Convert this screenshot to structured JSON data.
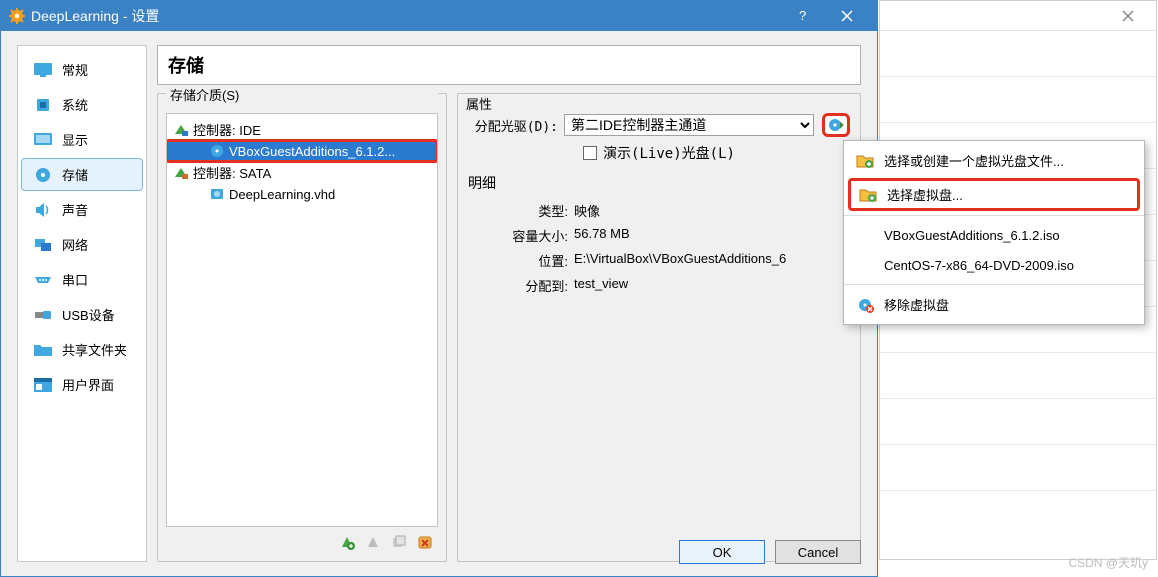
{
  "window": {
    "title": "DeepLearning - 设置"
  },
  "sidebar": {
    "items": [
      {
        "label": "常规",
        "icon": "monitor",
        "sel": false
      },
      {
        "label": "系统",
        "icon": "chip",
        "sel": false
      },
      {
        "label": "显示",
        "icon": "display",
        "sel": false
      },
      {
        "label": "存储",
        "icon": "disk",
        "sel": true
      },
      {
        "label": "声音",
        "icon": "speaker",
        "sel": false
      },
      {
        "label": "网络",
        "icon": "net",
        "sel": false
      },
      {
        "label": "串口",
        "icon": "serial",
        "sel": false
      },
      {
        "label": "USB设备",
        "icon": "usb",
        "sel": false
      },
      {
        "label": "共享文件夹",
        "icon": "folder",
        "sel": false
      },
      {
        "label": "用户界面",
        "icon": "ui",
        "sel": false
      }
    ]
  },
  "page": {
    "title": "存储"
  },
  "storage": {
    "media_legend": "存储介质(S)",
    "tree": [
      {
        "kind": "controller",
        "label": "控制器: IDE",
        "icon": "ide"
      },
      {
        "kind": "leaf",
        "label": "VBoxGuestAdditions_6.1.2...",
        "icon": "disc",
        "sel": true,
        "highlight": true
      },
      {
        "kind": "controller",
        "label": "控制器: SATA",
        "icon": "sata"
      },
      {
        "kind": "leaf",
        "label": "DeepLearning.vhd",
        "icon": "hdd",
        "sel": false
      }
    ]
  },
  "attrs": {
    "legend": "属性",
    "drive_label": "分配光驱(D):",
    "drive_value": "第二IDE控制器主通道",
    "live_checkbox": "演示(Live)光盘(L)",
    "details_legend": "明细",
    "rows": [
      {
        "label": "类型:",
        "value": "映像"
      },
      {
        "label": "容量大小:",
        "value": "56.78  MB"
      },
      {
        "label": "位置:",
        "value": "E:\\VirtualBox\\VBoxGuestAdditions_6"
      },
      {
        "label": "分配到:",
        "value": "test_view"
      }
    ]
  },
  "popup": {
    "items": [
      {
        "label": "选择或创建一个虚拟光盘文件...",
        "icon": "folder-add"
      },
      {
        "label": "选择虚拟盘...",
        "icon": "folder-add",
        "highlight": true
      }
    ],
    "recent": [
      "VBoxGuestAdditions_6.1.2.iso",
      "CentOS-7-x86_64-DVD-2009.iso"
    ],
    "remove": "移除虚拟盘"
  },
  "buttons": {
    "ok": "OK",
    "cancel": "Cancel"
  },
  "watermark": "CSDN @天玑y"
}
